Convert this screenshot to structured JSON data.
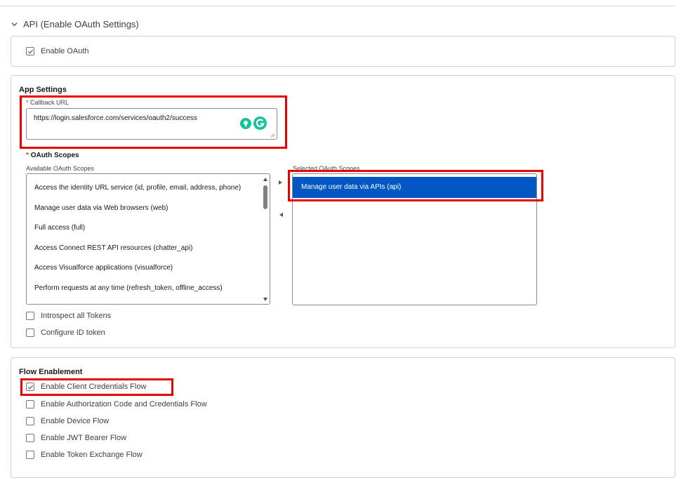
{
  "section": {
    "title": "API (Enable OAuth Settings)"
  },
  "enable_oauth": {
    "label": "Enable OAuth",
    "checked": true
  },
  "app_settings": {
    "heading": "App Settings",
    "callback": {
      "required_mark": "*",
      "label": "Callback URL",
      "value": "https://login.salesforce.com/services/oauth2/success"
    },
    "scopes": {
      "required_mark": "*",
      "label": "OAuth Scopes",
      "available_label": "Available OAuth Scopes",
      "selected_label": "Selected OAuth Scopes",
      "available": [
        "Access the identity URL service (id, profile, email, address, phone)",
        "Manage user data via Web browsers (web)",
        "Full access (full)",
        "Access Connect REST API resources (chatter_api)",
        "Access Visualforce applications (visualforce)",
        "Perform requests at any time (refresh_token, offline_access)"
      ],
      "selected": [
        "Manage user data via APIs (api)"
      ]
    },
    "introspect": {
      "label": "Introspect all Tokens",
      "checked": false
    },
    "id_token": {
      "label": "Configure ID token",
      "checked": false
    }
  },
  "flow": {
    "heading": "Flow Enablement",
    "items": [
      {
        "label": "Enable Client Credentials Flow",
        "checked": true
      },
      {
        "label": "Enable Authorization Code and Credentials Flow",
        "checked": false
      },
      {
        "label": "Enable Device Flow",
        "checked": false
      },
      {
        "label": "Enable JWT Bearer Flow",
        "checked": false
      },
      {
        "label": "Enable Token Exchange Flow",
        "checked": false
      }
    ]
  },
  "colors": {
    "accent": "#0257c4",
    "highlight": "#e60000",
    "grammarly": "#15c39a"
  }
}
